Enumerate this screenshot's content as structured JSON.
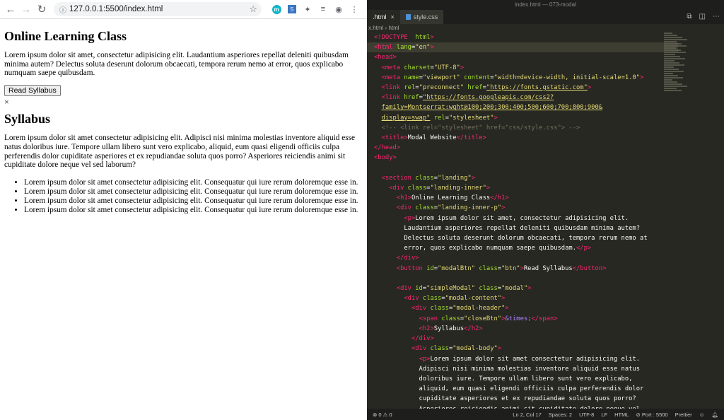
{
  "browser": {
    "url": "127.0.0.1:5500/index.html",
    "extensions": [
      "m",
      "5",
      "puzzle-icon",
      "playlist-icon",
      "account-icon",
      "more-icon"
    ]
  },
  "page": {
    "heading": "Online Learning Class",
    "intro": "Lorem ipsum dolor sit amet, consectetur adipisicing elit. Laudantium asperiores repellat deleniti quibusdam minima autem? Delectus soluta deserunt dolorum obcaecati, tempora rerum nemo at error, quos explicabo numquam saepe quibusdam.",
    "button_label": "Read Syllabus",
    "close_symbol": "×",
    "modal_title": "Syllabus",
    "modal_body": "Lorem ipsum dolor sit amet consectetur adipisicing elit. Adipisci nisi minima molestias inventore aliquid esse natus doloribus iure. Tempore ullam libero sunt vero explicabo, aliquid, eum quasi eligendi officiis culpa perferendis dolor cupiditate asperiores et ex repudiandae soluta quos porro? Asperiores reiciendis animi sit cupiditate dolore neque vel sed laborum?",
    "list": [
      "Lorem ipsum dolor sit amet consectetur adipisicing elit. Consequatur qui iure rerum doloremque esse in.",
      "Lorem ipsum dolor sit amet consectetur adipisicing elit. Consequatur qui iure rerum doloremque esse in.",
      "Lorem ipsum dolor sit amet consectetur adipisicing elit. Consequatur qui iure rerum doloremque esse in.",
      "Lorem ipsum dolor sit amet consectetur adipisicing elit. Consequatur qui iure rerum doloremque esse in."
    ]
  },
  "editor": {
    "window_title": "index.html — 073-modal",
    "tabs": [
      {
        "label": ".html",
        "active": true
      },
      {
        "label": "style.css",
        "active": false
      }
    ],
    "breadcrumb": "x.html  ›  html",
    "statusbar": {
      "problems": "⊗ 0 ⚠ 0",
      "position": "Ln 2, Col 17",
      "spaces": "Spaces: 2",
      "encoding": "UTF-8",
      "eol": "LF",
      "language": "HTML",
      "port": "⊘ Port : 5500",
      "formatter": "Prettier"
    },
    "code_lines": [
      [
        [
          "t-tag",
          "<!DOCTYPE"
        ],
        [
          "",
          "  "
        ],
        [
          "t-attr",
          "html"
        ],
        [
          "t-tag",
          ">"
        ]
      ],
      [
        [
          "t-tag",
          "<html"
        ],
        [
          "",
          " "
        ],
        [
          "t-attr",
          "lang"
        ],
        [
          "",
          "="
        ],
        [
          "t-str",
          "\"en\""
        ],
        [
          "t-tag",
          ">"
        ]
      ],
      [
        [
          "t-tag",
          "<head>"
        ]
      ],
      [
        [
          "",
          "  "
        ],
        [
          "t-tag",
          "<meta"
        ],
        [
          "",
          " "
        ],
        [
          "t-attr",
          "charset"
        ],
        [
          "",
          "="
        ],
        [
          "t-str",
          "\"UTF-8\""
        ],
        [
          "t-tag",
          ">"
        ]
      ],
      [
        [
          "",
          "  "
        ],
        [
          "t-tag",
          "<meta"
        ],
        [
          "",
          " "
        ],
        [
          "t-attr",
          "name"
        ],
        [
          "",
          "="
        ],
        [
          "t-str",
          "\"viewport\""
        ],
        [
          "",
          " "
        ],
        [
          "t-attr",
          "content"
        ],
        [
          "",
          "="
        ],
        [
          "t-str",
          "\"width=device-width, initial-scale=1.0\""
        ],
        [
          "t-tag",
          ">"
        ]
      ],
      [
        [
          "",
          "  "
        ],
        [
          "t-tag",
          "<link"
        ],
        [
          "",
          " "
        ],
        [
          "t-attr",
          "rel"
        ],
        [
          "",
          "="
        ],
        [
          "t-str",
          "\"preconnect\""
        ],
        [
          "",
          " "
        ],
        [
          "t-attr",
          "href"
        ],
        [
          "",
          "="
        ],
        [
          "t-str-u",
          "\"https://fonts.gstatic.com\""
        ],
        [
          "t-tag",
          ">"
        ]
      ],
      [
        [
          "",
          "  "
        ],
        [
          "t-tag",
          "<link"
        ],
        [
          "",
          " "
        ],
        [
          "t-attr",
          "href"
        ],
        [
          "",
          "="
        ],
        [
          "t-str-u",
          "\"https://fonts.googleapis.com/css2?"
        ]
      ],
      [
        [
          "",
          "  "
        ],
        [
          "t-str-u",
          "family=Montserrat:wght@100;200;300;400;500;600;700;800;900&"
        ]
      ],
      [
        [
          "",
          "  "
        ],
        [
          "t-str-u",
          "display=swap\""
        ],
        [
          "",
          " "
        ],
        [
          "t-attr",
          "rel"
        ],
        [
          "",
          "="
        ],
        [
          "t-str",
          "\"stylesheet\""
        ],
        [
          "t-tag",
          ">"
        ]
      ],
      [
        [
          "",
          "  "
        ],
        [
          "t-com",
          "<!-- <link rel=\"stylesheet\" href=\"css/style.css\"> -->"
        ]
      ],
      [
        [
          "",
          "  "
        ],
        [
          "t-tag",
          "<title>"
        ],
        [
          "",
          "Modal Website"
        ],
        [
          "t-tag",
          "</title>"
        ]
      ],
      [
        [
          "t-tag",
          "</head>"
        ]
      ],
      [
        [
          "t-tag",
          "<body>"
        ]
      ],
      [
        [
          "",
          " "
        ]
      ],
      [
        [
          "",
          "  "
        ],
        [
          "t-tag",
          "<section"
        ],
        [
          "",
          " "
        ],
        [
          "t-attr",
          "class"
        ],
        [
          "",
          "="
        ],
        [
          "t-str",
          "\"landing\""
        ],
        [
          "t-tag",
          ">"
        ]
      ],
      [
        [
          "",
          "    "
        ],
        [
          "t-tag",
          "<div"
        ],
        [
          "",
          " "
        ],
        [
          "t-attr",
          "class"
        ],
        [
          "",
          "="
        ],
        [
          "t-str",
          "\"landing-inner\""
        ],
        [
          "t-tag",
          ">"
        ]
      ],
      [
        [
          "",
          "      "
        ],
        [
          "t-tag",
          "<h1>"
        ],
        [
          "",
          "Online Learning Class"
        ],
        [
          "t-tag",
          "</h1>"
        ]
      ],
      [
        [
          "",
          "      "
        ],
        [
          "t-tag",
          "<div"
        ],
        [
          "",
          " "
        ],
        [
          "t-attr",
          "class"
        ],
        [
          "",
          "="
        ],
        [
          "t-str",
          "\"landing-inner-p\""
        ],
        [
          "t-tag",
          ">"
        ]
      ],
      [
        [
          "",
          "        "
        ],
        [
          "t-tag",
          "<p>"
        ],
        [
          "",
          "Lorem ipsum dolor sit amet, consectetur adipisicing elit."
        ]
      ],
      [
        [
          "",
          "        Laudantium asperiores repellat deleniti quibusdam minima autem?"
        ]
      ],
      [
        [
          "",
          "        Delectus soluta deserunt dolorum obcaecati, tempora rerum nemo at"
        ]
      ],
      [
        [
          "",
          "        error, quos explicabo numquam saepe quibusdam."
        ],
        [
          "t-tag",
          "</p>"
        ]
      ],
      [
        [
          "",
          "      "
        ],
        [
          "t-tag",
          "</div>"
        ]
      ],
      [
        [
          "",
          "      "
        ],
        [
          "t-tag",
          "<button"
        ],
        [
          "",
          " "
        ],
        [
          "t-attr",
          "id"
        ],
        [
          "",
          "="
        ],
        [
          "t-str",
          "\"modalBtn\""
        ],
        [
          "",
          " "
        ],
        [
          "t-attr",
          "class"
        ],
        [
          "",
          "="
        ],
        [
          "t-str",
          "\"btn\""
        ],
        [
          "t-tag",
          ">"
        ],
        [
          "",
          "Read Syllabus"
        ],
        [
          "t-tag",
          "</button>"
        ]
      ],
      [
        [
          "",
          " "
        ]
      ],
      [
        [
          "",
          "      "
        ],
        [
          "t-tag",
          "<div"
        ],
        [
          "",
          " "
        ],
        [
          "t-attr",
          "id"
        ],
        [
          "",
          "="
        ],
        [
          "t-str",
          "\"simpleModal\""
        ],
        [
          "",
          " "
        ],
        [
          "t-attr",
          "class"
        ],
        [
          "",
          "="
        ],
        [
          "t-str",
          "\"modal\""
        ],
        [
          "t-tag",
          ">"
        ]
      ],
      [
        [
          "",
          "        "
        ],
        [
          "t-tag",
          "<div"
        ],
        [
          "",
          " "
        ],
        [
          "t-attr",
          "class"
        ],
        [
          "",
          "="
        ],
        [
          "t-str",
          "\"modal-content\""
        ],
        [
          "t-tag",
          ">"
        ]
      ],
      [
        [
          "",
          "          "
        ],
        [
          "t-tag",
          "<div"
        ],
        [
          "",
          " "
        ],
        [
          "t-attr",
          "class"
        ],
        [
          "",
          "="
        ],
        [
          "t-str",
          "\"modal-header\""
        ],
        [
          "t-tag",
          ">"
        ]
      ],
      [
        [
          "",
          "            "
        ],
        [
          "t-tag",
          "<span"
        ],
        [
          "",
          " "
        ],
        [
          "t-attr",
          "class"
        ],
        [
          "",
          "="
        ],
        [
          "t-str",
          "\"closeBtn\""
        ],
        [
          "t-tag",
          ">"
        ],
        [
          "t-ent",
          "&times;"
        ],
        [
          "t-tag",
          "</span>"
        ]
      ],
      [
        [
          "",
          "            "
        ],
        [
          "t-tag",
          "<h2>"
        ],
        [
          "",
          "Syllabus"
        ],
        [
          "t-tag",
          "</h2>"
        ]
      ],
      [
        [
          "",
          "          "
        ],
        [
          "t-tag",
          "</div>"
        ]
      ],
      [
        [
          "",
          "          "
        ],
        [
          "t-tag",
          "<div"
        ],
        [
          "",
          " "
        ],
        [
          "t-attr",
          "class"
        ],
        [
          "",
          "="
        ],
        [
          "t-str",
          "\"modal-body\""
        ],
        [
          "t-tag",
          ">"
        ]
      ],
      [
        [
          "",
          "            "
        ],
        [
          "t-tag",
          "<p>"
        ],
        [
          "",
          "Lorem ipsum dolor sit amet consectetur adipisicing elit."
        ]
      ],
      [
        [
          "",
          "            Adipisci nisi minima molestias inventore aliquid esse natus"
        ]
      ],
      [
        [
          "",
          "            doloribus iure. Tempore ullam libero sunt vero explicabo,"
        ]
      ],
      [
        [
          "",
          "            aliquid, eum quasi eligendi officiis culpa perferendis dolor"
        ]
      ],
      [
        [
          "",
          "            cupiditate asperiores et ex repudiandae soluta quos porro?"
        ]
      ],
      [
        [
          "",
          "            Asperiores reiciendis animi sit cupiditate dolore neque vel"
        ]
      ]
    ]
  }
}
